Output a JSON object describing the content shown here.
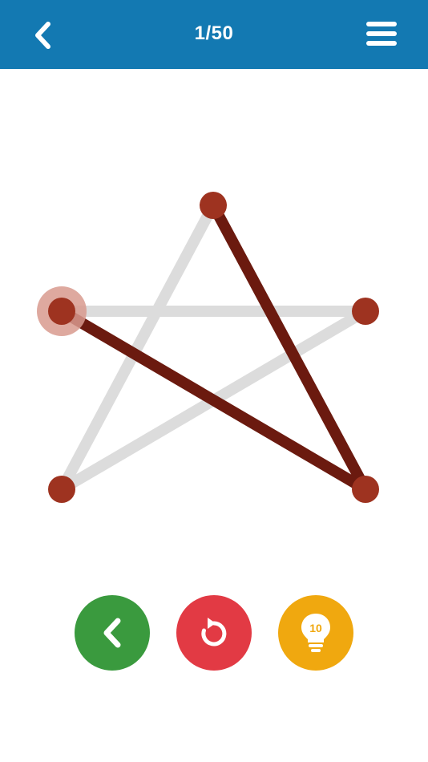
{
  "header": {
    "level_label": "1/50",
    "back_icon": "chevron-left-icon",
    "menu_icon": "hamburger-menu-icon"
  },
  "puzzle": {
    "shape": "pentagram",
    "colors": {
      "vertex": "#9e3320",
      "drawn_line": "#6b1a0f",
      "undrawn_line": "#dcdcdc",
      "active_vertex_halo": "#d89a8e"
    },
    "vertices": [
      {
        "id": "top"
      },
      {
        "id": "right"
      },
      {
        "id": "bottom-right"
      },
      {
        "id": "bottom-left"
      },
      {
        "id": "left",
        "active": true
      }
    ],
    "edges": [
      {
        "from": "top",
        "to": "bottom-left",
        "drawn": false
      },
      {
        "from": "left",
        "to": "right",
        "drawn": false
      },
      {
        "from": "right",
        "to": "bottom-left",
        "drawn": false
      },
      {
        "from": "top",
        "to": "bottom-right",
        "drawn": true
      },
      {
        "from": "left",
        "to": "bottom-right",
        "drawn": true
      }
    ]
  },
  "controls": {
    "prev": {
      "icon": "chevron-left-icon",
      "color": "#3a9a3e"
    },
    "reset": {
      "icon": "restart-icon",
      "color": "#e23a44"
    },
    "hint": {
      "icon": "lightbulb-icon",
      "color": "#f0a80f",
      "count": "10"
    }
  },
  "colors": {
    "header_bg": "#1379b2",
    "header_text": "#ffffff",
    "background": "#ffffff"
  }
}
